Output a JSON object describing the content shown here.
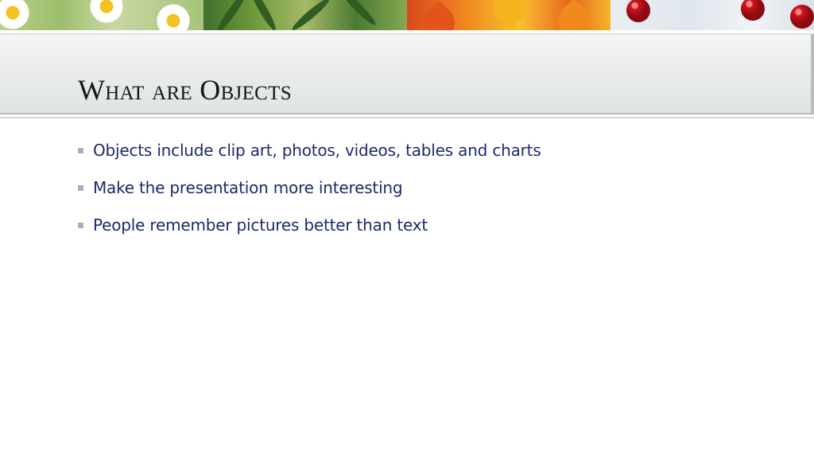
{
  "slide": {
    "title": "What are Objects",
    "bullets": [
      "Objects include clip art, photos, videos, tables and charts",
      "Make the presentation more interesting",
      "People remember pictures better than text"
    ]
  },
  "banner": {
    "panels": [
      "spring-flowers-image",
      "summer-palm-image",
      "autumn-leaves-image",
      "winter-berries-image"
    ]
  },
  "colors": {
    "title_text": "#0f1c14",
    "bullet_text": "#1b2a6b",
    "bullet_marker": "#a9b1b3",
    "title_bar": "#dfe4e2"
  }
}
